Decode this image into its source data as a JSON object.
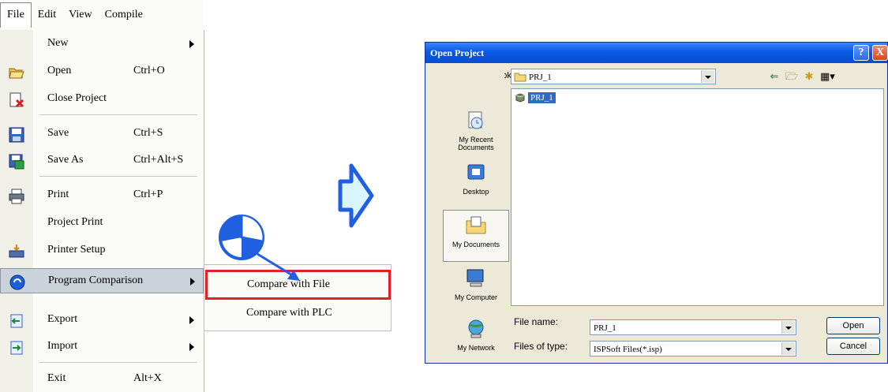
{
  "menubar": {
    "items": [
      "File",
      "Edit",
      "View",
      "Compile"
    ]
  },
  "file_menu": {
    "new": {
      "label": "New",
      "shortcut": ""
    },
    "open": {
      "label": "Open",
      "shortcut": "Ctrl+O"
    },
    "close_project": {
      "label": "Close Project",
      "shortcut": ""
    },
    "save": {
      "label": "Save",
      "shortcut": "Ctrl+S"
    },
    "save_as": {
      "label": "Save As",
      "shortcut": "Ctrl+Alt+S"
    },
    "print": {
      "label": "Print",
      "shortcut": "Ctrl+P"
    },
    "project_print": {
      "label": "Project Print",
      "shortcut": ""
    },
    "printer_setup": {
      "label": "Printer Setup",
      "shortcut": ""
    },
    "program_comparison": {
      "label": "Program Comparison",
      "shortcut": ""
    },
    "export": {
      "label": "Export",
      "shortcut": ""
    },
    "import": {
      "label": "Import",
      "shortcut": ""
    },
    "exit": {
      "label": "Exit",
      "shortcut": "Alt+X"
    }
  },
  "submenu": {
    "compare_with_file": "Compare with File",
    "compare_with_plc": "Compare with PLC"
  },
  "dialog": {
    "title": "Open Project",
    "look_in_label": "Look in:",
    "look_in_value": "PRJ_1",
    "places": [
      "My Recent Documents",
      "Desktop",
      "My Documents",
      "My Computer",
      "My Network"
    ],
    "files": [
      "PRJ_1"
    ],
    "file_name_label": "File name:",
    "file_name_value": "PRJ_1",
    "file_type_label": "Files of type:",
    "file_type_value": "ISPSoft Files(*.isp)",
    "open_button": "Open",
    "cancel_button": "Cancel",
    "help_glyph": "?",
    "close_glyph": "X"
  },
  "colors": {
    "highlight_border": "#e0202a",
    "title_bar": "#0a59e6",
    "selection": "#316ac5",
    "arrow_fill": "#d9f6ff",
    "arrow_stroke": "#1f5fe0"
  }
}
